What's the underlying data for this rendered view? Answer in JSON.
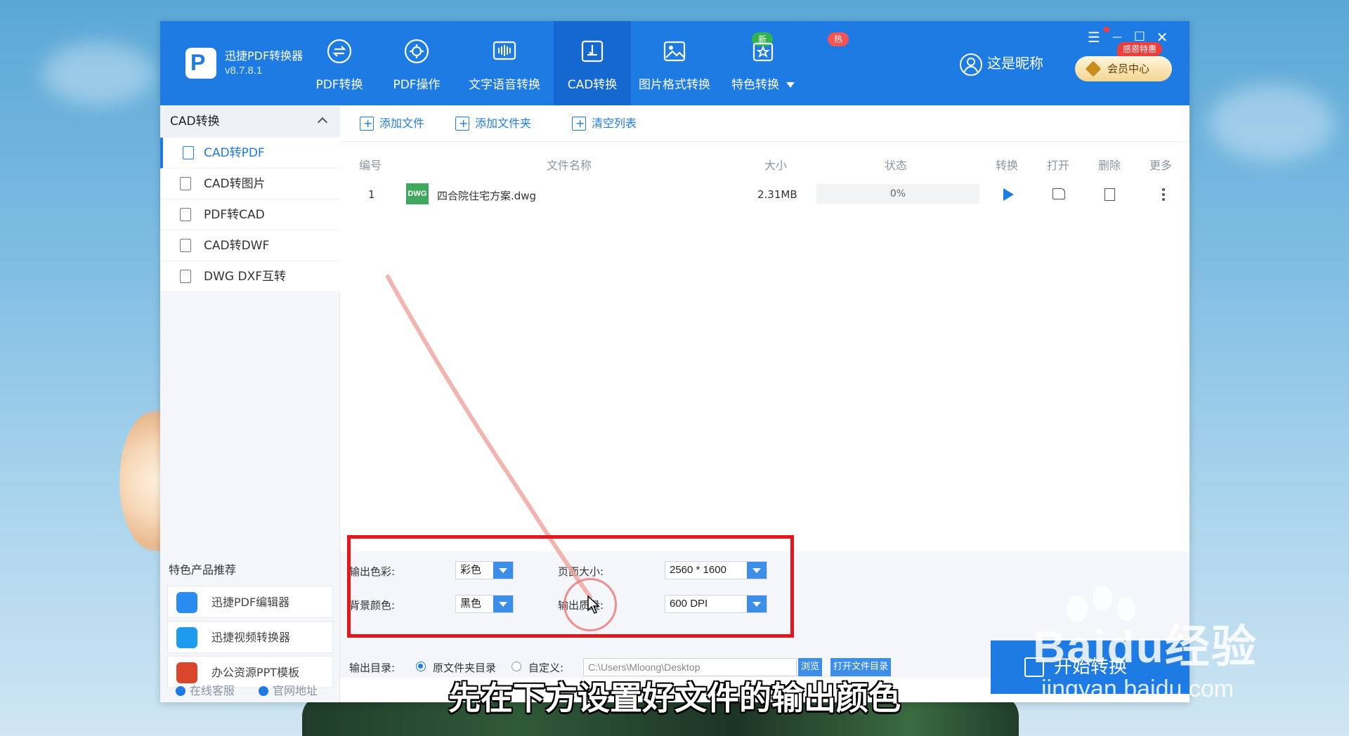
{
  "app": {
    "name": "迅捷PDF转换器",
    "version": "v8.7.8.1",
    "logo_letter": "P"
  },
  "nav": [
    {
      "label": "PDF转换",
      "icon": "pdf-convert-icon"
    },
    {
      "label": "PDF操作",
      "icon": "pdf-operate-icon"
    },
    {
      "label": "文字语音转换",
      "icon": "text-speech-icon"
    },
    {
      "label": "CAD转换",
      "icon": "cad-convert-icon",
      "active": true
    },
    {
      "label": "图片格式转换",
      "icon": "image-format-icon",
      "badge": "新"
    },
    {
      "label": "特色转换",
      "icon": "special-convert-icon",
      "badge": "热"
    }
  ],
  "user": {
    "name": "这是昵称"
  },
  "vip": {
    "label": "会员中心",
    "tag": "感恩特惠"
  },
  "window_controls": {
    "menu": "☰",
    "minimize": "—",
    "maximize": "☐",
    "close": "✕"
  },
  "sidebar": {
    "header": "CAD转换",
    "items": [
      {
        "label": "CAD转PDF",
        "active": true
      },
      {
        "label": "CAD转图片"
      },
      {
        "label": "PDF转CAD"
      },
      {
        "label": "CAD转DWF"
      },
      {
        "label": "DWG DXF互转"
      }
    ],
    "recommend_title": "特色产品推荐",
    "recommend": [
      {
        "label": "迅捷PDF编辑器"
      },
      {
        "label": "迅捷视频转换器"
      },
      {
        "label": "办公资源PPT模板"
      }
    ],
    "footer": {
      "service": "在线客服",
      "website": "官网地址"
    }
  },
  "toolbar": {
    "add_file": "添加文件",
    "add_folder": "添加文件夹",
    "clear_list": "清空列表"
  },
  "table": {
    "headers": {
      "index": "编号",
      "name": "文件名称",
      "size": "大小",
      "status": "状态",
      "convert": "转换",
      "open": "打开",
      "delete": "删除",
      "more": "更多"
    },
    "rows": [
      {
        "index": "1",
        "type": "DWG",
        "name": "四合院住宅方案.dwg",
        "size": "2.31MB",
        "progress": "0%"
      }
    ]
  },
  "settings": {
    "output_color_label": "输出色彩:",
    "output_color": "彩色",
    "bg_color_label": "背景颜色:",
    "bg_color": "黑色",
    "page_size_label": "页面大小:",
    "page_size": "2560 * 1600",
    "quality_label": "输出质量:",
    "quality": "600 DPI",
    "output_dir_label": "输出目录:",
    "dir_original": "原文件夹目录",
    "dir_custom": "自定义:",
    "path": "C:\\Users\\Mloong\\Desktop",
    "browse": "浏览",
    "open_folder": "打开文件目录",
    "start": "开始转换"
  },
  "subtitle": "先在下方设置好文件的输出颜色",
  "watermark": {
    "main": "Baidu经验",
    "sub": "jingyan.baidu.com"
  },
  "colors": {
    "brand": "#1f7be4",
    "highlight": "#e5171d"
  }
}
